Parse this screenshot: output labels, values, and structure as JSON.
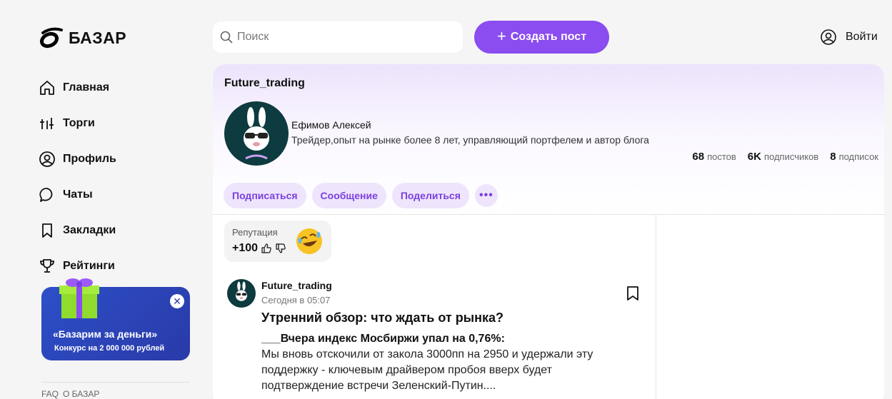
{
  "brand": {
    "name": "БАЗАР"
  },
  "search": {
    "placeholder": "Поиск"
  },
  "header": {
    "create_post": "Создать пост",
    "login": "Войти"
  },
  "sidebar": {
    "items": [
      {
        "label": "Главная",
        "icon": "home-icon"
      },
      {
        "label": "Торги",
        "icon": "trading-icon"
      },
      {
        "label": "Профиль",
        "icon": "profile-icon"
      },
      {
        "label": "Чаты",
        "icon": "chat-icon"
      },
      {
        "label": "Закладки",
        "icon": "bookmark-icon"
      },
      {
        "label": "Рейтинги",
        "icon": "trophy-icon"
      }
    ],
    "promo": {
      "title": "«Базарим за деньги»",
      "subtitle": "Конкурс на 2 000 000 рублей"
    },
    "footer_links": [
      "FAQ",
      "О БАЗАР"
    ]
  },
  "channel": {
    "title": "Future_trading",
    "author_name": "Ефимов Алексей",
    "author_desc": "Трейдер,опыт на рынке более 8 лет, управляющий портфелем и автор блога",
    "stats": {
      "posts_count": "68",
      "posts_label": "постов",
      "subscribers_count": "6K",
      "subscribers_label": "подписчиков",
      "subscriptions_count": "8",
      "subscriptions_label": "подписок"
    },
    "actions": {
      "subscribe": "Подписаться",
      "message": "Сообщение",
      "share": "Поделиться"
    }
  },
  "reputation": {
    "label": "Репутация",
    "value": "+100"
  },
  "post": {
    "author": "Future_trading",
    "time": "Сегодня в 05:07",
    "title": "Утренний обзор: что ждать от рынка?",
    "subtitle": "___Вчера индекс Мосбиржи упал на 0,76%:",
    "body": "Мы вновь отскочили от закола 3000пп на 2950 и удержали эту поддержку - ключевым драйвером пробоя вверх будет подтверждение встречи Зеленский-Путин...."
  },
  "colors": {
    "accent": "#8b4cf0",
    "pill_bg": "#eee5fc",
    "promo_bg": "#2a3aa8"
  }
}
